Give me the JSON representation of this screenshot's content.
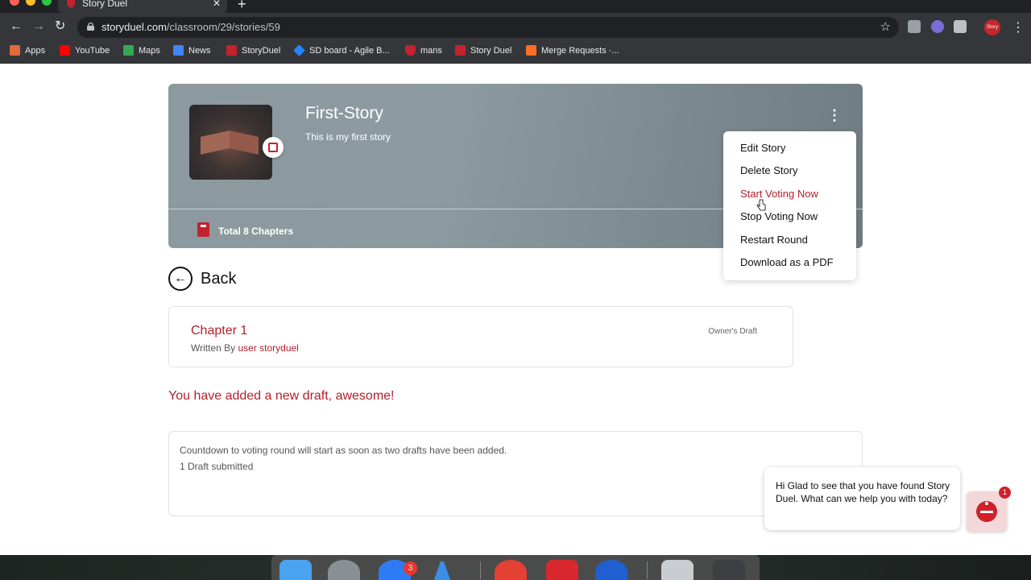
{
  "browser": {
    "tab_title": "Story Duel",
    "tab_close": "✕",
    "new_tab": "+",
    "url_domain": "storyduel.com",
    "url_path": "/classroom/29/stories/59",
    "back": "←",
    "forward": "→",
    "reload": "↻",
    "star": "☆",
    "menu": "⋮",
    "profile_label": "Story",
    "bookmarks": [
      {
        "label": "Apps",
        "icon": "apps-grid-icon",
        "color": "#e06a3b"
      },
      {
        "label": "YouTube",
        "icon": "youtube-icon",
        "color": "#ff0000"
      },
      {
        "label": "Maps",
        "icon": "maps-icon",
        "color": "#34a853"
      },
      {
        "label": "News",
        "icon": "news-icon",
        "color": "#4285f4"
      },
      {
        "label": "StoryDuel",
        "icon": "storyduel-icon",
        "color": "#c3232e"
      },
      {
        "label": "SD board - Agile B...",
        "icon": "jira-icon",
        "color": "#2684ff"
      },
      {
        "label": "mans",
        "icon": "shield-icon",
        "color": "#c3232e"
      },
      {
        "label": "Story Duel",
        "icon": "storyduel-icon",
        "color": "#c3232e"
      },
      {
        "label": "Merge Requests ·...",
        "icon": "gitlab-icon",
        "color": "#fc6d26"
      }
    ]
  },
  "story": {
    "title": "First-Story",
    "description": "This is my first story",
    "total_chapters": "Total 8 Chapters",
    "kebab": "⋮"
  },
  "menu": {
    "items": [
      {
        "label": "Edit Story",
        "active": false
      },
      {
        "label": "Delete Story",
        "active": false
      },
      {
        "label": "Start Voting Now",
        "active": true
      },
      {
        "label": "Stop Voting Now",
        "active": false
      },
      {
        "label": "Restart Round",
        "active": false
      },
      {
        "label": "Download as a PDF",
        "active": false
      }
    ]
  },
  "back": {
    "label": "Back",
    "arrow": "←"
  },
  "chapter": {
    "title": "Chapter 1",
    "written_by": "Written By ",
    "author": "user storyduel",
    "status": "Owner's Draft"
  },
  "notice": "You have added a new draft, awesome!",
  "countdown": {
    "line1": "Countdown to voting round will start as soon as two drafts have been added.",
    "line2": "1 Draft submitted"
  },
  "chat": {
    "message": "Hi Glad to see that you have found Story Duel. What can we help you with today?",
    "badge": "1"
  },
  "dock": {
    "badge": "3"
  },
  "colors": {
    "brand_red": "#b3202b",
    "header_grey": "#8c999f"
  }
}
